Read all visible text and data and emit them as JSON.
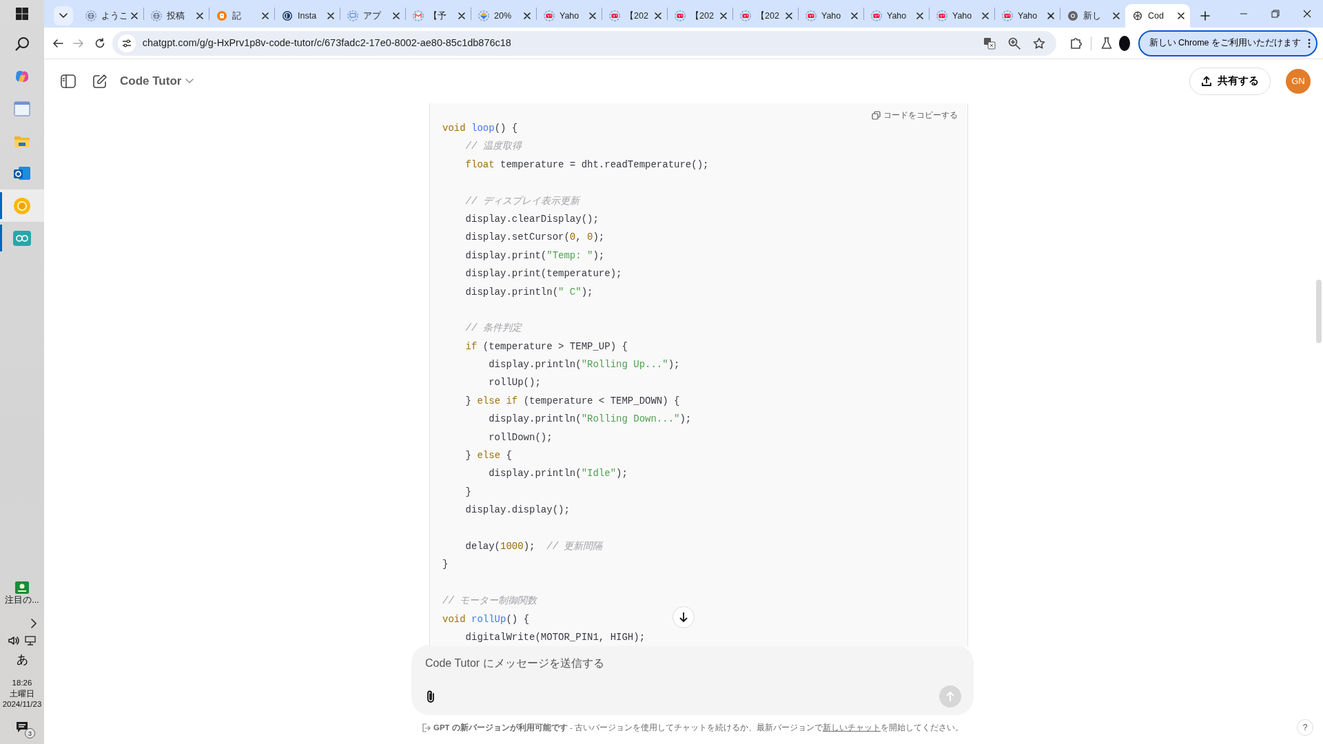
{
  "taskbar": {
    "apps": [
      {
        "active": false,
        "running": false
      },
      {
        "active": false,
        "running": false
      },
      {
        "active": false,
        "running": false
      },
      {
        "active": false,
        "running": false
      },
      {
        "active": false,
        "running": false
      },
      {
        "active": false,
        "running": false
      },
      {
        "active": true,
        "running": true
      },
      {
        "active": false,
        "running": true
      }
    ],
    "widget": "注目の...",
    "ime": "あ",
    "time": "18:26",
    "day": "土曜日",
    "date": "2024/11/23",
    "notifications": "3"
  },
  "browser": {
    "tabs": [
      {
        "label": "ようこ",
        "selected": false
      },
      {
        "label": "投稿",
        "selected": false
      },
      {
        "label": "記",
        "selected": false
      },
      {
        "label": "Insta",
        "selected": false
      },
      {
        "label": "アプ",
        "selected": false
      },
      {
        "label": "【予",
        "selected": false
      },
      {
        "label": "20%",
        "selected": false
      },
      {
        "label": "Yaho",
        "selected": false
      },
      {
        "label": "【202",
        "selected": false
      },
      {
        "label": "【202",
        "selected": false
      },
      {
        "label": "【202",
        "selected": false
      },
      {
        "label": "Yaho",
        "selected": false
      },
      {
        "label": "Yaho",
        "selected": false
      },
      {
        "label": "Yaho",
        "selected": false
      },
      {
        "label": "Yaho",
        "selected": false
      },
      {
        "label": "新し",
        "selected": false
      },
      {
        "label": "Cod",
        "selected": true
      }
    ],
    "address": "chatgpt.com/g/g-HxPrv1p8v-code-tutor/c/673fadc2-17e0-8002-ae80-85c1db876c18",
    "promo": "新しい Chrome をご利用いただけます"
  },
  "chat": {
    "title": "Code Tutor",
    "share": "共有する",
    "avatar": "GN",
    "copy_label": "コードをコピーする",
    "code": [
      {
        "tokens": [
          {
            "kind": "keyword",
            "text": "void"
          },
          {
            "kind": "function",
            "text": " loop"
          },
          {
            "kind": "plain",
            "text": "() {"
          }
        ]
      },
      {
        "tokens": [
          {
            "kind": "comment",
            "text": "    // 温度取得"
          }
        ]
      },
      {
        "tokens": [
          {
            "kind": "keyword",
            "text": "    float"
          },
          {
            "kind": "plain",
            "text": " temperature = dht.readTemperature();"
          }
        ]
      },
      {
        "kind": "blank"
      },
      {
        "tokens": [
          {
            "kind": "comment",
            "text": "    // ディスプレイ表示更新"
          }
        ]
      },
      {
        "tokens": [
          {
            "kind": "plain",
            "text": "    display.clearDisplay();"
          }
        ]
      },
      {
        "tokens": [
          {
            "kind": "plain",
            "text": "    display.setCursor("
          },
          {
            "kind": "number",
            "text": "0"
          },
          {
            "kind": "plain",
            "text": ", "
          },
          {
            "kind": "number",
            "text": "0"
          },
          {
            "kind": "plain",
            "text": ");"
          }
        ]
      },
      {
        "tokens": [
          {
            "kind": "plain",
            "text": "    display.print("
          },
          {
            "kind": "string",
            "text": "\"Temp: \""
          },
          {
            "kind": "plain",
            "text": ");"
          }
        ]
      },
      {
        "tokens": [
          {
            "kind": "plain",
            "text": "    display.print(temperature);"
          }
        ]
      },
      {
        "tokens": [
          {
            "kind": "plain",
            "text": "    display.println("
          },
          {
            "kind": "string",
            "text": "\" C\""
          },
          {
            "kind": "plain",
            "text": ");"
          }
        ]
      },
      {
        "kind": "blank"
      },
      {
        "tokens": [
          {
            "kind": "comment",
            "text": "    // 条件判定"
          }
        ]
      },
      {
        "tokens": [
          {
            "kind": "keyword",
            "text": "    if"
          },
          {
            "kind": "plain",
            "text": " (temperature > TEMP_UP) {"
          }
        ]
      },
      {
        "tokens": [
          {
            "kind": "plain",
            "text": "        display.println("
          },
          {
            "kind": "string",
            "text": "\"Rolling Up...\""
          },
          {
            "kind": "plain",
            "text": ");"
          }
        ]
      },
      {
        "tokens": [
          {
            "kind": "plain",
            "text": "        rollUp();"
          }
        ]
      },
      {
        "tokens": [
          {
            "kind": "plain",
            "text": "    } "
          },
          {
            "kind": "keyword",
            "text": "else if"
          },
          {
            "kind": "plain",
            "text": " (temperature < TEMP_DOWN) {"
          }
        ]
      },
      {
        "tokens": [
          {
            "kind": "plain",
            "text": "        display.println("
          },
          {
            "kind": "string",
            "text": "\"Rolling Down...\""
          },
          {
            "kind": "plain",
            "text": ");"
          }
        ]
      },
      {
        "tokens": [
          {
            "kind": "plain",
            "text": "        rollDown();"
          }
        ]
      },
      {
        "tokens": [
          {
            "kind": "plain",
            "text": "    } "
          },
          {
            "kind": "keyword",
            "text": "else"
          },
          {
            "kind": "plain",
            "text": " {"
          }
        ]
      },
      {
        "tokens": [
          {
            "kind": "plain",
            "text": "        display.println("
          },
          {
            "kind": "string",
            "text": "\"Idle\""
          },
          {
            "kind": "plain",
            "text": ");"
          }
        ]
      },
      {
        "tokens": [
          {
            "kind": "plain",
            "text": "    }"
          }
        ]
      },
      {
        "tokens": [
          {
            "kind": "plain",
            "text": "    display.display();"
          }
        ]
      },
      {
        "kind": "blank"
      },
      {
        "tokens": [
          {
            "kind": "plain",
            "text": "    delay("
          },
          {
            "kind": "number",
            "text": "1000"
          },
          {
            "kind": "plain",
            "text": ");"
          },
          {
            "kind": "comment",
            "text": "  // 更新間隔"
          }
        ]
      },
      {
        "tokens": [
          {
            "kind": "plain",
            "text": "}"
          }
        ]
      },
      {
        "kind": "blank"
      },
      {
        "tokens": [
          {
            "kind": "comment",
            "text": "// モーター制御関数"
          }
        ]
      },
      {
        "tokens": [
          {
            "kind": "keyword",
            "text": "void"
          },
          {
            "kind": "function",
            "text": " rollUp"
          },
          {
            "kind": "plain",
            "text": "() {"
          }
        ]
      },
      {
        "tokens": [
          {
            "kind": "plain",
            "text": "    digitalWrite(MOTOR_PIN1, HIGH);"
          }
        ]
      }
    ],
    "input": {
      "placeholder": "Code Tutor にメッセージを送信する"
    },
    "footer": {
      "text": "**GPT の新バージョンが利用可能です** - 古いバージョンを使用してチャットを続けるか、最新バージョンで",
      "link": "新しいチャット",
      "after": "を開始してください。"
    },
    "help": "?"
  }
}
